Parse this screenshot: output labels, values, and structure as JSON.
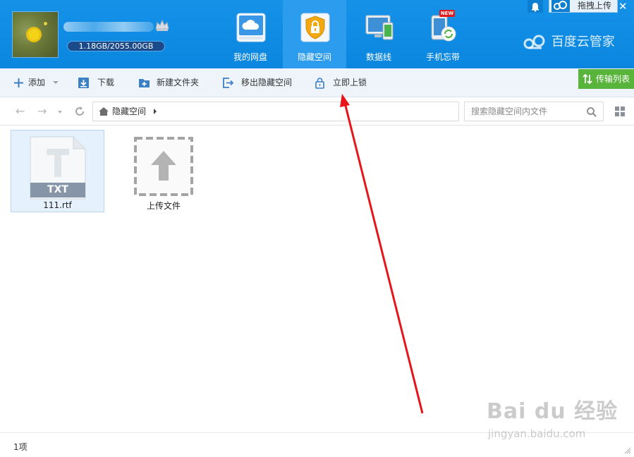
{
  "header": {
    "quota": "1.18GB/2055.00GB",
    "nav": [
      {
        "label": "我的网盘"
      },
      {
        "label": "隐藏空间"
      },
      {
        "label": "数据线"
      },
      {
        "label": "手机忘带"
      }
    ],
    "new_badge": "NEW",
    "logo_text": "百度云管家",
    "drag_upload": "拖拽上传",
    "close": "✕"
  },
  "toolbar": {
    "add": "添加",
    "download": "下载",
    "new_folder": "新建文件夹",
    "move_out": "移出隐藏空间",
    "lock_now": "立即上锁",
    "transfer_list": "传输列表"
  },
  "addressbar": {
    "back": "←",
    "forward": "→",
    "crumb": "隐藏空间",
    "search_placeholder": "搜索隐藏空间内文件"
  },
  "files": {
    "item1": {
      "type_label": "TXT",
      "name": "111.rtf"
    },
    "upload_label": "上传文件"
  },
  "status": {
    "count": "1项"
  },
  "watermark": {
    "big": "Bai du 经验",
    "small": "jingyan.baidu.com"
  },
  "colors": {
    "header_blue": "#0e8de6",
    "active_tab": "#2c9cee",
    "transfer_green": "#58b43a",
    "annotation_red": "#e8141a"
  }
}
